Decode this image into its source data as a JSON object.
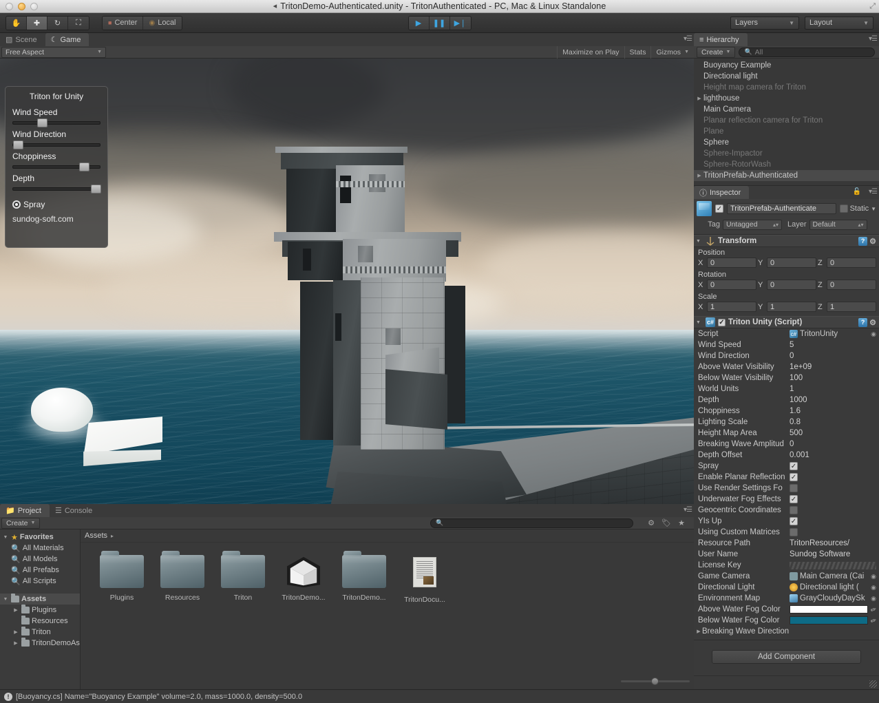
{
  "window": {
    "title": "TritonDemo-Authenticated.unity - TritonAuthenticated - PC, Mac & Linux Standalone",
    "unity_icon": "unity-logo-icon",
    "close_icon": "close-icon",
    "minimize_icon": "minimize-icon",
    "maximize_icon": "maximize-icon",
    "resize_icon": "resize-icon"
  },
  "toolbar": {
    "tools": [
      {
        "name": "hand-tool",
        "icon": "hand-icon",
        "active": false
      },
      {
        "name": "move-tool",
        "icon": "move-arrows-icon",
        "active": true
      },
      {
        "name": "rotate-tool",
        "icon": "rotate-icon",
        "active": false
      },
      {
        "name": "scale-tool",
        "icon": "scale-icon",
        "active": false
      }
    ],
    "pivot_label": "Center",
    "pivot_icon": "pivot-center-icon",
    "space_label": "Local",
    "space_icon": "globe-local-icon",
    "play_label": "play-icon",
    "pause_label": "pause-icon",
    "step_label": "step-icon",
    "layers_label": "Layers",
    "layout_label": "Layout",
    "caret": "▾"
  },
  "game_panel": {
    "tabs": [
      {
        "label": "Scene",
        "icon": "grid-icon",
        "active": false
      },
      {
        "label": "Game",
        "icon": "gamepad-icon",
        "active": true
      }
    ],
    "aspect": "Free Aspect",
    "maximize_on_play": "Maximize on Play",
    "stats": "Stats",
    "gizmos": "Gizmos",
    "menu_icon": "panel-menu-icon"
  },
  "triton_overlay": {
    "title": "Triton for Unity",
    "sliders": [
      {
        "label": "Wind Speed",
        "position_pct": 28
      },
      {
        "label": "Wind Direction",
        "position_pct": 2
      },
      {
        "label": "Choppiness",
        "position_pct": 86
      },
      {
        "label": "Depth",
        "position_pct": 98
      }
    ],
    "spray_label": "Spray",
    "spray_checked": true,
    "footer": "sundog-soft.com"
  },
  "project_panel": {
    "tabs": [
      {
        "label": "Project",
        "icon": "folder-icon",
        "active": true
      },
      {
        "label": "Console",
        "icon": "console-icon",
        "active": false
      }
    ],
    "create_label": "Create",
    "search_placeholder": "",
    "search_icon": "search-icon",
    "filter_icons": [
      "filter-by-type-icon",
      "filter-by-label-icon",
      "favorite-star-icon"
    ],
    "breadcrumb": "Assets",
    "breadcrumb_caret": "▸",
    "tree": [
      {
        "label": "Favorites",
        "icon": "star-icon",
        "depth": 0,
        "arrow": "▼",
        "selected": false
      },
      {
        "label": "All Materials",
        "icon": "search-icon",
        "depth": 1,
        "arrow": "",
        "selected": false
      },
      {
        "label": "All Models",
        "icon": "search-icon",
        "depth": 1,
        "arrow": "",
        "selected": false
      },
      {
        "label": "All Prefabs",
        "icon": "search-icon",
        "depth": 1,
        "arrow": "",
        "selected": false
      },
      {
        "label": "All Scripts",
        "icon": "search-icon",
        "depth": 1,
        "arrow": "",
        "selected": false
      },
      {
        "label": "Assets",
        "icon": "folder-icon",
        "depth": 0,
        "arrow": "▼",
        "selected": true
      },
      {
        "label": "Plugins",
        "icon": "folder-icon",
        "depth": 1,
        "arrow": "▸",
        "selected": false
      },
      {
        "label": "Resources",
        "icon": "folder-icon",
        "depth": 1,
        "arrow": "",
        "selected": false
      },
      {
        "label": "Triton",
        "icon": "folder-icon",
        "depth": 1,
        "arrow": "▸",
        "selected": false
      },
      {
        "label": "TritonDemoAs",
        "icon": "folder-icon",
        "depth": 1,
        "arrow": "▸",
        "selected": false
      }
    ],
    "assets": [
      {
        "label": "Plugins",
        "kind": "folder"
      },
      {
        "label": "Resources",
        "kind": "folder"
      },
      {
        "label": "Triton",
        "kind": "folder"
      },
      {
        "label": "TritonDemo...",
        "kind": "unity-scene"
      },
      {
        "label": "TritonDemo...",
        "kind": "folder"
      },
      {
        "label": "TritonDocu...",
        "kind": "document"
      }
    ]
  },
  "hierarchy": {
    "title": "Hierarchy",
    "icon": "hierarchy-icon",
    "create_label": "Create",
    "search_placeholder": "All",
    "search_icon": "search-icon",
    "menu_icon": "panel-menu-icon",
    "items": [
      {
        "label": "Buoyancy Example",
        "dim": false,
        "arrow": "",
        "selected": false
      },
      {
        "label": "Directional light",
        "dim": false,
        "arrow": "",
        "selected": false
      },
      {
        "label": "Height map camera for Triton",
        "dim": true,
        "arrow": "",
        "selected": false
      },
      {
        "label": "lighthouse",
        "dim": false,
        "arrow": "▸",
        "selected": false
      },
      {
        "label": "Main Camera",
        "dim": false,
        "arrow": "",
        "selected": false
      },
      {
        "label": "Planar reflection camera for Triton",
        "dim": true,
        "arrow": "",
        "selected": false
      },
      {
        "label": "Plane",
        "dim": true,
        "arrow": "",
        "selected": false
      },
      {
        "label": "Sphere",
        "dim": false,
        "arrow": "",
        "selected": false
      },
      {
        "label": "Sphere-Impactor",
        "dim": true,
        "arrow": "",
        "selected": false
      },
      {
        "label": "Sphere-RotorWash",
        "dim": true,
        "arrow": "",
        "selected": false
      },
      {
        "label": "TritonPrefab-Authenticated",
        "dim": false,
        "arrow": "▸",
        "selected": true
      }
    ]
  },
  "inspector": {
    "title": "Inspector",
    "icon": "info-icon",
    "lock_icon": "lock-open-icon",
    "menu_icon": "panel-menu-icon",
    "object_name": "TritonPrefab-Authenticate",
    "object_enabled": true,
    "object_icon": "prefab-cube-icon",
    "static_label": "Static",
    "static_checked": false,
    "tag_label": "Tag",
    "tag_value": "Untagged",
    "layer_label": "Layer",
    "layer_value": "Default",
    "transform": {
      "title": "Transform",
      "icon": "transform-icon",
      "help_icon": "help-icon",
      "gear_icon": "gear-icon",
      "position_label": "Position",
      "position": {
        "x": "0",
        "y": "0",
        "z": "0"
      },
      "rotation_label": "Rotation",
      "rotation": {
        "x": "0",
        "y": "0",
        "z": "0"
      },
      "scale_label": "Scale",
      "scale": {
        "x": "1",
        "y": "1",
        "z": "1"
      },
      "axes": {
        "x": "X",
        "y": "Y",
        "z": "Z"
      }
    },
    "triton_script": {
      "title": "Triton Unity (Script)",
      "enabled": true,
      "icon": "cs-script-icon",
      "help_icon": "help-icon",
      "gear_icon": "gear-icon",
      "properties": [
        {
          "name": "Script",
          "value": "TritonUnity",
          "type": "object",
          "ref_icon": "cs-script-icon",
          "ref_color": "#3a7fae"
        },
        {
          "name": "Wind Speed",
          "value": "5",
          "type": "text"
        },
        {
          "name": "Wind Direction",
          "value": "0",
          "type": "text"
        },
        {
          "name": "Above Water Visibility",
          "value": "1e+09",
          "type": "text"
        },
        {
          "name": "Below Water Visibility",
          "value": "100",
          "type": "text"
        },
        {
          "name": "World Units",
          "value": "1",
          "type": "text"
        },
        {
          "name": "Depth",
          "value": "1000",
          "type": "text"
        },
        {
          "name": "Choppiness",
          "value": "1.6",
          "type": "text"
        },
        {
          "name": "Lighting Scale",
          "value": "0.8",
          "type": "text"
        },
        {
          "name": "Height Map Area",
          "value": "500",
          "type": "text"
        },
        {
          "name": "Breaking Wave Amplitud",
          "value": "0",
          "type": "text"
        },
        {
          "name": "Depth Offset",
          "value": "0.001",
          "type": "text"
        },
        {
          "name": "Spray",
          "value": true,
          "type": "checkbox"
        },
        {
          "name": "Enable Planar Reflection",
          "value": true,
          "type": "checkbox"
        },
        {
          "name": "Use Render Settings Fo",
          "value": false,
          "type": "checkbox"
        },
        {
          "name": "Underwater Fog Effects",
          "value": true,
          "type": "checkbox"
        },
        {
          "name": "Geocentric Coordinates",
          "value": false,
          "type": "checkbox"
        },
        {
          "name": "YIs Up",
          "value": true,
          "type": "checkbox"
        },
        {
          "name": "Using Custom Matrices",
          "value": false,
          "type": "checkbox"
        },
        {
          "name": "Resource Path",
          "value": "TritonResources/",
          "type": "text"
        },
        {
          "name": "User Name",
          "value": "Sundog Software",
          "type": "text"
        },
        {
          "name": "License Key",
          "value": "",
          "type": "masked"
        },
        {
          "name": "Game Camera",
          "value": "Main Camera (Cai",
          "type": "object",
          "ref_icon": "camera-icon",
          "ref_color": "#7f9aa0"
        },
        {
          "name": "Directional Light",
          "value": "Directional light (",
          "type": "object",
          "ref_icon": "light-icon",
          "ref_color": "#e0b030"
        },
        {
          "name": "Environment Map",
          "value": "GrayCloudyDaySk",
          "type": "object",
          "ref_icon": "cubemap-icon",
          "ref_color": "#5a96c8"
        },
        {
          "name": "Above Water Fog Color",
          "value": "#ffffff",
          "type": "color"
        },
        {
          "name": "Below Water Fog Color",
          "value": "#0e6b86",
          "type": "color"
        },
        {
          "name": "Breaking Wave Direction",
          "value": "",
          "type": "foldout",
          "arrow": "▸"
        }
      ]
    },
    "add_component_label": "Add Component"
  },
  "statusbar": {
    "icon": "info-icon",
    "message": "[Buoyancy.cs] Name=\"Buoyancy Example\" volume=2.0, mass=1000.0, density=500.0"
  },
  "colors": {
    "accent_blue": "#3ea5e0",
    "panel_bg": "#383838",
    "toolbar_bg": "#3d3d3d",
    "selection": "#4a4a4a",
    "sea": "#12465a",
    "sky": "#8a8277"
  }
}
